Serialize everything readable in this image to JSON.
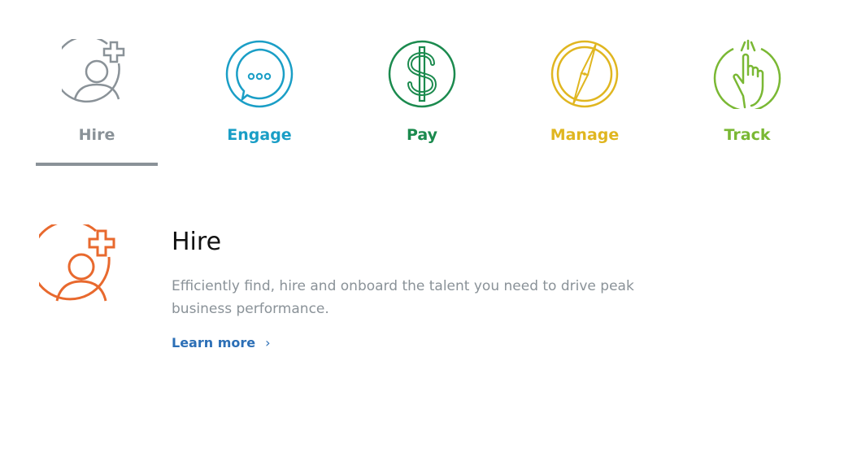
{
  "tabs": [
    {
      "id": "hire",
      "label": "Hire",
      "color": "#8a9298",
      "icon": "person-plus-icon",
      "active": true
    },
    {
      "id": "engage",
      "label": "Engage",
      "color": "#1a9ec6",
      "icon": "chat-bubble-icon",
      "active": false
    },
    {
      "id": "pay",
      "label": "Pay",
      "color": "#1b8a4e",
      "icon": "dollar-icon",
      "active": false
    },
    {
      "id": "manage",
      "label": "Manage",
      "color": "#e0b620",
      "icon": "compass-icon",
      "active": false
    },
    {
      "id": "track",
      "label": "Track",
      "color": "#7ab834",
      "icon": "pointer-hand-icon",
      "active": false
    }
  ],
  "panel": {
    "title": "Hire",
    "description": "Efficiently find, hire and onboard the talent you need to drive peak business performance.",
    "learn_more": "Learn more",
    "chevron": "›",
    "icon": "person-plus-icon",
    "icon_color": "#e8692e"
  }
}
